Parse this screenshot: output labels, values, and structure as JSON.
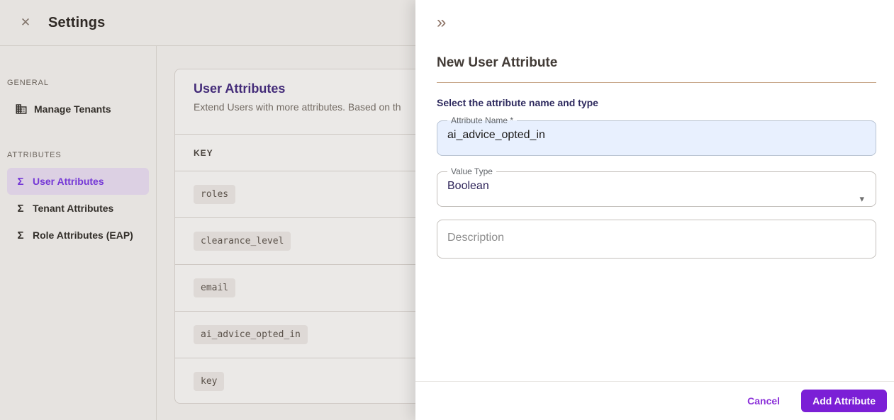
{
  "header": {
    "title": "Settings"
  },
  "icons": {
    "close": "✕",
    "collapse": "»",
    "sigma": "Σ",
    "caret": "▾"
  },
  "sidebar": {
    "sections": [
      {
        "label": "GENERAL",
        "items": [
          {
            "label": "Manage Tenants",
            "icon": "building-icon",
            "selected": false
          }
        ]
      },
      {
        "label": "ATTRIBUTES",
        "items": [
          {
            "label": "User Attributes",
            "icon": "sigma-icon",
            "selected": true
          },
          {
            "label": "Tenant Attributes",
            "icon": "sigma-icon",
            "selected": false
          },
          {
            "label": "Role Attributes (EAP)",
            "icon": "sigma-icon",
            "selected": false
          }
        ]
      }
    ]
  },
  "main": {
    "card": {
      "title": "User Attributes",
      "description": "Extend Users with more attributes. Based on th",
      "table": {
        "columns": [
          "KEY"
        ],
        "rows": [
          "roles",
          "clearance_level",
          "email",
          "ai_advice_opted_in",
          "key"
        ]
      }
    }
  },
  "drawer": {
    "title": "New User Attribute",
    "subtitle": "Select the attribute name and type",
    "fields": {
      "attribute_name": {
        "label": "Attribute Name *",
        "value": "ai_advice_opted_in"
      },
      "value_type": {
        "label": "Value Type",
        "value": "Boolean"
      },
      "description": {
        "placeholder": "Description"
      }
    },
    "footer": {
      "cancel_label": "Cancel",
      "add_label": "Add Attribute"
    }
  },
  "colors": {
    "accent_purple": "#7b1fd6",
    "selected_item_bg": "#efe4fb",
    "selected_item_text": "#7c3aed",
    "card_title_purple": "#462d85",
    "drawer_divider_tan": "#c9a98d",
    "autofill_blue": "#e8f0fe"
  }
}
